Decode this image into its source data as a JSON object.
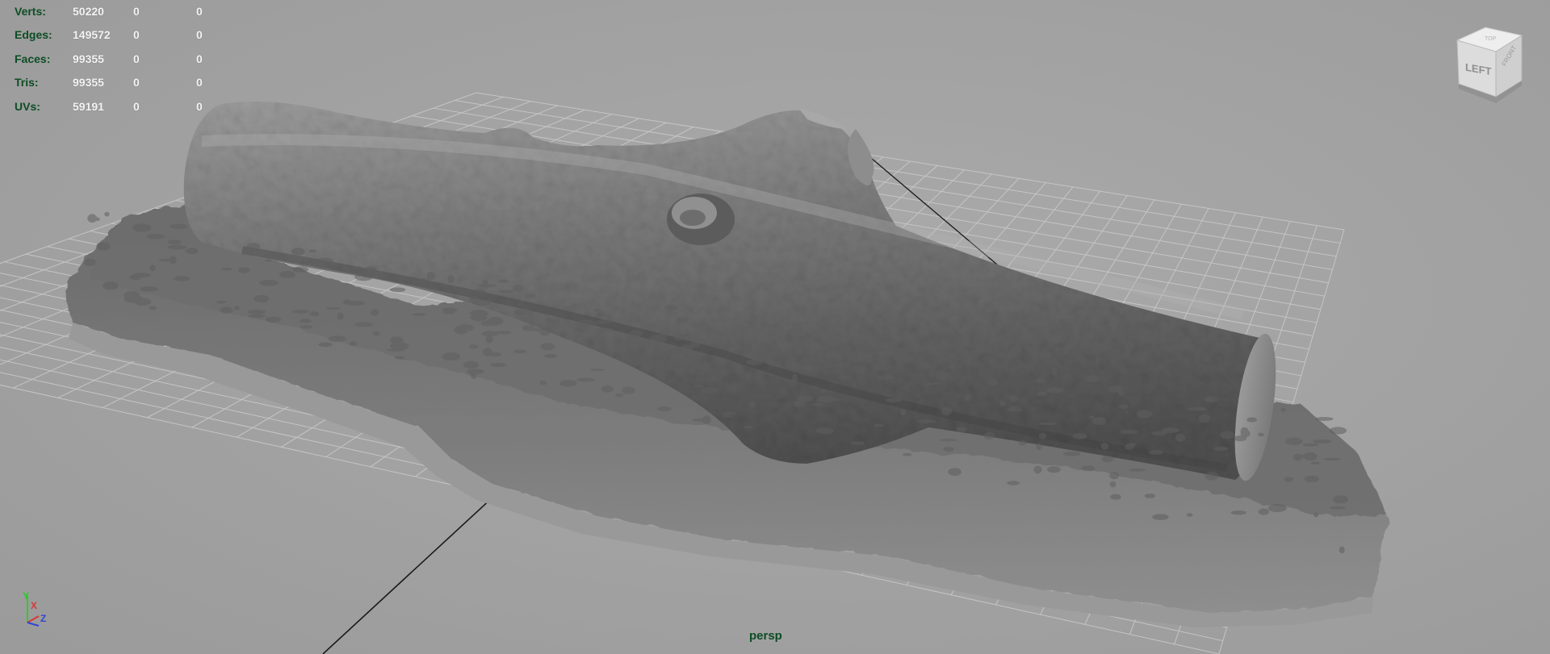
{
  "hud": {
    "rows": [
      {
        "label": "Verts:",
        "total": "50220",
        "selected": "0",
        "component": "0"
      },
      {
        "label": "Edges:",
        "total": "149572",
        "selected": "0",
        "component": "0"
      },
      {
        "label": "Faces:",
        "total": "99355",
        "selected": "0",
        "component": "0"
      },
      {
        "label": "Tris:",
        "total": "99355",
        "selected": "0",
        "component": "0"
      },
      {
        "label": "UVs:",
        "total": "59191",
        "selected": "0",
        "component": "0"
      }
    ]
  },
  "view_cube": {
    "face_label": "LEFT",
    "icon": "view-cube-icon"
  },
  "camera": {
    "name": "persp"
  },
  "axis_gizmo": {
    "x": "X",
    "y": "Y",
    "z": "Z"
  },
  "colors": {
    "background": "#a2a2a2",
    "grid": "#c4c4c4",
    "hud_label": "#0d4d24",
    "hud_value": "#f4f4f4",
    "axis_x": "#d63a3a",
    "axis_y": "#30c830",
    "axis_z": "#2f46d8"
  }
}
